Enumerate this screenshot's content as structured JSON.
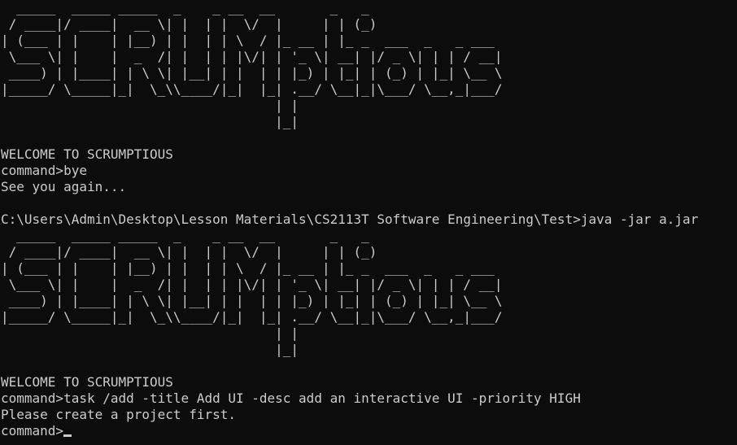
{
  "terminal": {
    "lines": [
      "  _____  _____ _____  _    _ __  __       _   _",
      " / ____|/ ____|  __ \\| |  | |  \\/  |     | | (_)",
      "| (___ | |    | |__) | |  | | \\  / |_ __ | |_ _  ___  _   _ ___",
      " \\___ \\| |    |  _  /| |  | | |\\/| | '_ \\| __| |/ _ \\| | | / __|",
      " ____) | |____| | \\ \\| |__| | |  | | |_) | |_| | (_) | |_| \\__ \\",
      "|_____/ \\_____|_|  \\_\\\\____/|_|  |_| .__/ \\__|_|\\___/ \\__,_|___/",
      "                                   | |",
      "                                   |_|",
      "",
      "WELCOME TO SCRUMPTIOUS",
      "command>bye",
      "See you again...",
      "",
      "C:\\Users\\Admin\\Desktop\\Lesson Materials\\CS2113T Software Engineering\\Test>java -jar a.jar",
      "  _____  _____ _____  _    _ __  __       _   _",
      " / ____|/ ____|  __ \\| |  | |  \\/  |     | | (_)",
      "| (___ | |    | |__) | |  | | \\  / |_ __ | |_ _  ___  _   _ ___",
      " \\___ \\| |    |  _  /| |  | | |\\/| | '_ \\| __| |/ _ \\| | | / __|",
      " ____) | |____| | \\ \\| |__| | |  | | |_) | |_| | (_) | |_| \\__ \\",
      "|_____/ \\_____|_|  \\_\\\\____/|_|  |_| .__/ \\__|_|\\___/ \\__,_|___/",
      "                                   | |",
      "                                   |_|",
      "",
      "WELCOME TO SCRUMPTIOUS",
      "command>task /add -title Add UI -desc add an interactive UI -priority HIGH",
      "Please create a project first."
    ],
    "prompt": "command>",
    "current_input": ""
  },
  "colors": {
    "background": "#0c0c0c",
    "foreground": "#cccccc"
  }
}
